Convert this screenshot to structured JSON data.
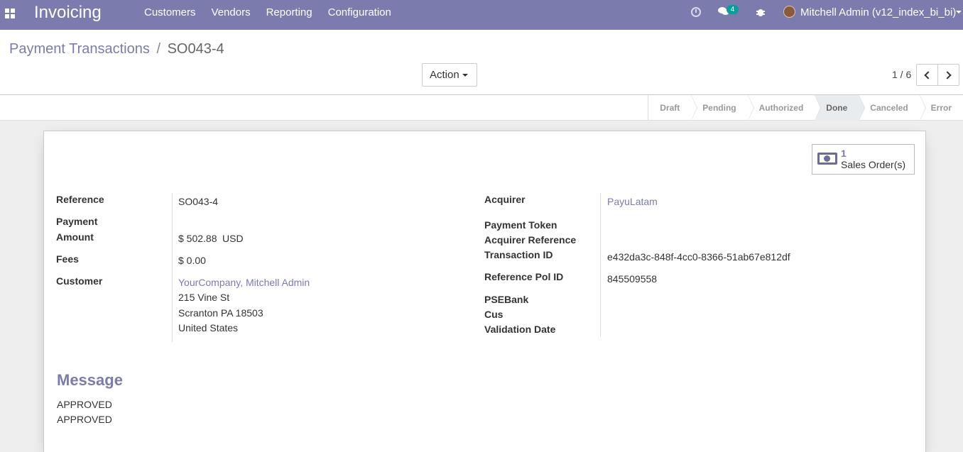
{
  "navbar": {
    "brand": "Invoicing",
    "menu": [
      "Customers",
      "Vendors",
      "Reporting",
      "Configuration"
    ],
    "chat_badge": "4",
    "user": "Mitchell Admin (v12_index_bi_bi)"
  },
  "breadcrumb": {
    "parent": "Payment Transactions",
    "separator": "/",
    "current": "SO043-4"
  },
  "toolbar": {
    "action_label": "Action",
    "pager": "1 / 6"
  },
  "status": {
    "steps": [
      "Draft",
      "Pending",
      "Authorized",
      "Done",
      "Canceled",
      "Error"
    ],
    "active": "Done"
  },
  "smart_button": {
    "count": "1",
    "label": "Sales Order(s)"
  },
  "form": {
    "reference_label": "Reference",
    "reference": "SO043-4",
    "payment_amount_label_1": "Payment",
    "payment_amount_label_2": "Amount",
    "amount": "$ 502.88",
    "currency": "USD",
    "fees_label": "Fees",
    "fees": "$ 0.00",
    "customer_label": "Customer",
    "customer_name": "YourCompany, Mitchell Admin",
    "address_1": "215 Vine St",
    "address_2": "Scranton PA 18503",
    "address_3": "United States",
    "acquirer_label": "Acquirer",
    "acquirer": "PayuLatam",
    "payment_token_label": "Payment Token",
    "acquirer_reference_label": "Acquirer Reference",
    "transaction_id_label": "Transaction ID",
    "transaction_id": "e432da3c-848f-4cc0-8366-51ab67e812df",
    "reference_pol_label": "Reference Pol ID",
    "reference_pol": "845509558",
    "psebank_label": "PSEBank",
    "cus_label": "Cus",
    "validation_date_label": "Validation Date"
  },
  "message": {
    "title": "Message",
    "line_1": "APPROVED",
    "line_2": "APPROVED"
  }
}
